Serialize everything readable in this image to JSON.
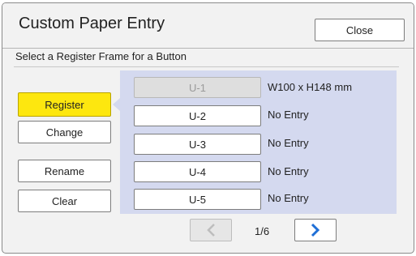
{
  "header": {
    "title": "Custom Paper Entry",
    "close_label": "Close"
  },
  "instruction": "Select a Register Frame for a Button",
  "actions": [
    {
      "label": "Register",
      "selected": true
    },
    {
      "label": "Change",
      "selected": false
    },
    {
      "label": "Rename",
      "selected": false
    },
    {
      "label": "Clear",
      "selected": false
    }
  ],
  "slots": [
    {
      "label": "U-1",
      "status": "W100 x H148 mm",
      "disabled": true
    },
    {
      "label": "U-2",
      "status": "No Entry",
      "disabled": false
    },
    {
      "label": "U-3",
      "status": "No Entry",
      "disabled": false
    },
    {
      "label": "U-4",
      "status": "No Entry",
      "disabled": false
    },
    {
      "label": "U-5",
      "status": "No Entry",
      "disabled": false
    }
  ],
  "pagination": {
    "page_text": "1/6",
    "prev_icon": "chevron-left-icon",
    "next_icon": "chevron-right-icon",
    "prev_disabled": true
  },
  "colors": {
    "selected_button": "#fde70f",
    "panel_background": "#d4d9ef",
    "next_arrow": "#1f6fd6"
  }
}
